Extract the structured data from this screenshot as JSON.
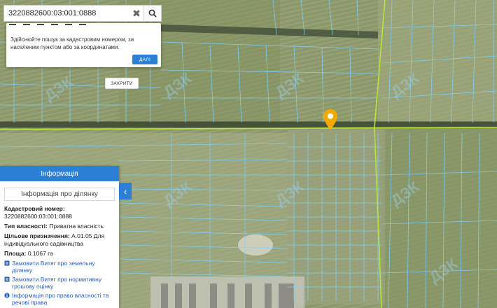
{
  "search": {
    "value": "3220882600:03:001:0888",
    "clear_glyph": "✖",
    "search_icon": "search-icon"
  },
  "tooltip": {
    "message": "Здійснюйте пошук за кадастровим номером, за населеним пунктом або за координатами.",
    "close_label": "ЗАКРИТИ",
    "ok_label": "ДАЛІ"
  },
  "panel": {
    "header": "Інформація",
    "title": "Інформація про ділянку",
    "cadastral_label": "Кадастровий номер:",
    "cadastral_value": "3220882600:03:001:0888",
    "ownership_label": "Тип власності:",
    "ownership_value": "Приватна власність",
    "purpose_label": "Цільове призначення:",
    "purpose_value": "A.01.05 Для індивідуального садівництва",
    "area_label": "Площа:",
    "area_value": "0.1067 га",
    "links": [
      "Замовити Витяг про земельну ділянку",
      "Замовити Витяг про нормативну грошову оцінку",
      "Інформація про право власності та речові права"
    ],
    "collapse_glyph": "‹"
  },
  "map": {
    "watermark": "ДЗК",
    "parcel_color": "#7fd2ff",
    "road_color": "#b6e63a",
    "marker_color": "#f2a900"
  }
}
